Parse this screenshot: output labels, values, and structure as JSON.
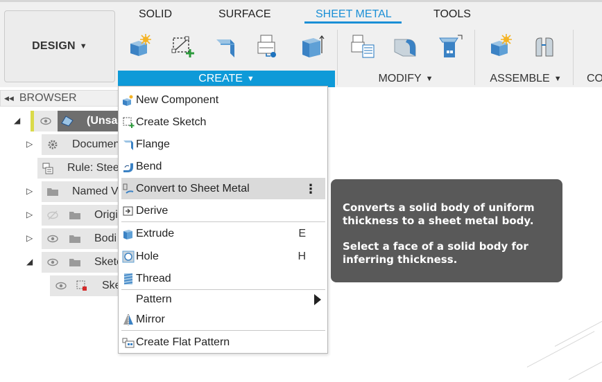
{
  "toolbar": {
    "design_label": "DESIGN",
    "tabs": [
      {
        "label": "SOLID"
      },
      {
        "label": "SURFACE"
      },
      {
        "label": "SHEET METAL"
      },
      {
        "label": "TOOLS"
      }
    ],
    "active_tab": "SHEET METAL",
    "groups": {
      "create": "CREATE",
      "modify": "MODIFY",
      "assemble": "ASSEMBLE",
      "more": "CO"
    },
    "icons": [
      "new-component-icon",
      "create-sketch-icon",
      "flange-icon",
      "sheet-metal-rules-icon",
      "extrude-icon",
      "rules-table-icon",
      "convert-icon",
      "unfold-icon",
      "assemble-component-icon",
      "joint-icon"
    ]
  },
  "browser": {
    "title": "BROWSER",
    "items": [
      {
        "label": "(Unsa"
      },
      {
        "label": "Documen"
      },
      {
        "label": "Rule: Stee"
      },
      {
        "label": "Named V"
      },
      {
        "label": "Origi"
      },
      {
        "label": "Bodi"
      },
      {
        "label": "Sketc"
      },
      {
        "label": "Ske"
      }
    ]
  },
  "create_menu": {
    "items": [
      {
        "label": "New Component",
        "icon": "new-component-icon"
      },
      {
        "label": "Create Sketch",
        "icon": "create-sketch-icon"
      },
      {
        "label": "Flange",
        "icon": "flange-icon"
      },
      {
        "label": "Bend",
        "icon": "bend-icon"
      },
      {
        "label": "Convert to Sheet Metal",
        "icon": "convert-sheet-metal-icon"
      },
      {
        "label": "Derive",
        "icon": "derive-icon"
      },
      {
        "label": "Extrude",
        "icon": "extrude-icon",
        "shortcut": "E"
      },
      {
        "label": "Hole",
        "icon": "hole-icon",
        "shortcut": "H"
      },
      {
        "label": "Thread",
        "icon": "thread-icon"
      },
      {
        "label": "Pattern"
      },
      {
        "label": "Mirror",
        "icon": "mirror-icon"
      },
      {
        "label": "Create Flat Pattern",
        "icon": "flat-pattern-icon"
      }
    ]
  },
  "tooltip": {
    "line1": "Converts a solid body of uniform thickness to a sheet metal body.",
    "line2": "Select a face of a solid body for inferring thickness."
  },
  "colors": {
    "accent": "#0e9ad8",
    "tooltip_bg": "#595959",
    "toolbar_bg": "#f0f0f0"
  }
}
